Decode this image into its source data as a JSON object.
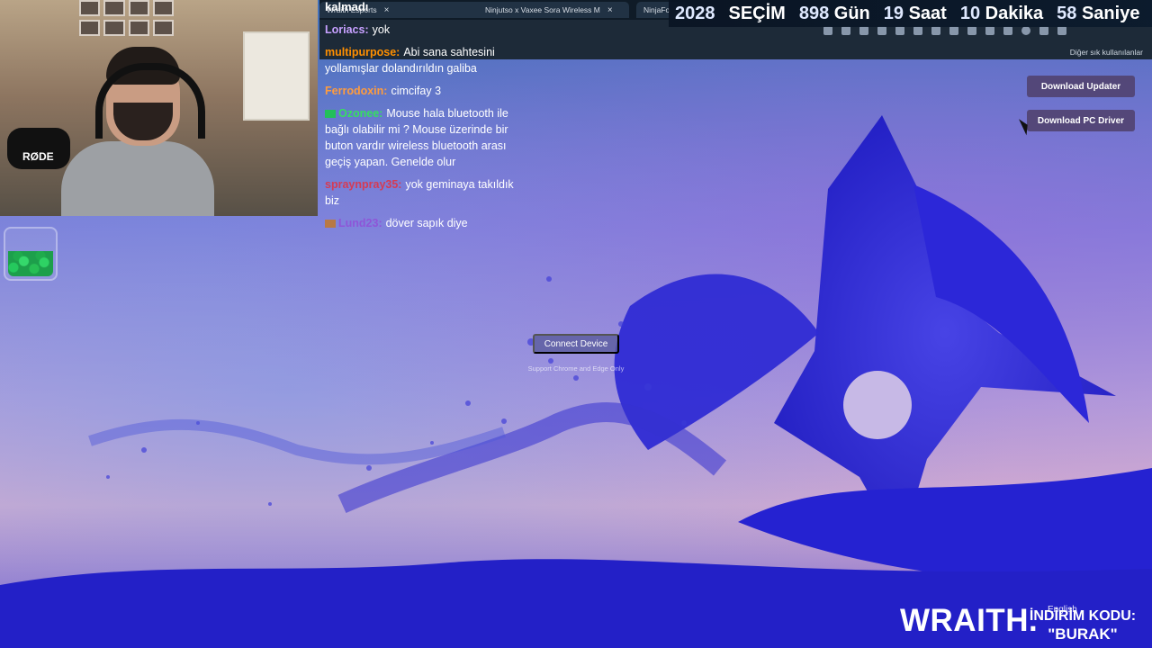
{
  "browser": {
    "tabs": [
      {
        "label": "Wraith Esports"
      },
      {
        "label": "Ninjutso x Vaxee Sora Wireless M"
      },
      {
        "label": "NinjaFo"
      }
    ],
    "bookmarks_label": "Diğer sık kullanılanlar"
  },
  "overlay": {
    "countdown": {
      "year": "2028",
      "title": "SEÇİM",
      "days": "898",
      "days_label": "Gün",
      "hours": "19",
      "hours_label": "Saat",
      "minutes": "10",
      "minutes_label": "Dakika",
      "seconds": "58",
      "seconds_label": "Saniye"
    },
    "chat_top": "kalmadı",
    "chat": [
      {
        "user": "Loriacs:",
        "text": "yok",
        "color": "#c7a0ff",
        "badge": ""
      },
      {
        "user": "multipurpose:",
        "text": "Abi sana sahtesini yollamışlar dolandırıldın galiba",
        "color": "#ff8f00",
        "badge": ""
      },
      {
        "user": "Ferrodoxin:",
        "text": "cimcifay 3",
        "color": "#ff9c3d",
        "badge": ""
      },
      {
        "user": "Ozonee:",
        "text": "Mouse hala bluetooth ile bağlı olabilir mi ? Mouse üzerinde bir buton vardır wireless bluetooth arası geçiş yapan. Genelde olur",
        "color": "#36df5f",
        "badge": "green"
      },
      {
        "user": "spraynpray35:",
        "text": "yok geminaya takıldık biz",
        "color": "#d53b54",
        "badge": ""
      },
      {
        "user": "Lund23:",
        "text": "döver sapık diye",
        "color": "#8e55d8",
        "badge": "brown"
      }
    ]
  },
  "page": {
    "download_updater": "Download Updater",
    "download_pc_driver": "Download PC Driver",
    "connect_device": "Connect Device",
    "connect_subtext": "Support Chrome and Edge Only",
    "footer": {
      "logo": "WRAITH.",
      "code_line1": "İNDİRİM KODU:",
      "code_line2": "\"BURAK\"",
      "language": "English"
    }
  },
  "colors": {
    "accent": "#6f66e6",
    "button": "#524574"
  }
}
